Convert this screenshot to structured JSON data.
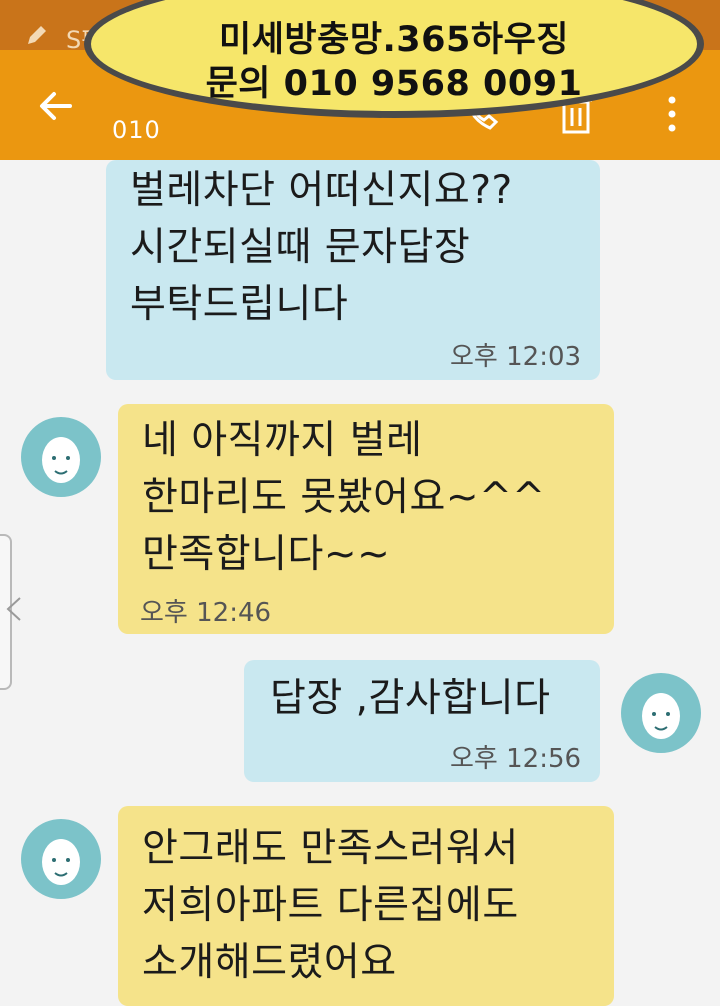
{
  "status_bar": {
    "spen_hint": "S펜을 분리하여"
  },
  "header": {
    "contact_number": "010"
  },
  "watermark": {
    "line1": "미세방충망.365하우징",
    "line2": "문의 010 9568 0091"
  },
  "messages": [
    {
      "direction": "outgoing",
      "lines": [
        "벌레차단  어떠신지요??",
        "시간되실때 문자답장",
        "부탁드립니다"
      ],
      "time": "오후 12:03"
    },
    {
      "direction": "incoming",
      "lines": [
        "네 아직까지 벌레",
        "한마리도 못봤어요~^^",
        "만족합니다~~"
      ],
      "time": "오후 12:46"
    },
    {
      "direction": "outgoing",
      "lines": [
        "답장 ,감사합니다"
      ],
      "time": "오후 12:56"
    },
    {
      "direction": "incoming",
      "lines": [
        "안그래도 만족스러워서",
        "저희아파트 다른집에도",
        "소개해드렸어요"
      ],
      "time": ""
    }
  ],
  "colors": {
    "appbar": "#eb9710",
    "outgoing_bubble": "#c9e8f0",
    "incoming_bubble": "#f5e38a",
    "avatar": "#7cc3c9"
  },
  "icons": [
    "pen-icon",
    "back-arrow-icon",
    "call-icon",
    "delete-icon",
    "more-options-icon",
    "avatar-icon",
    "chevron-left-icon"
  ]
}
